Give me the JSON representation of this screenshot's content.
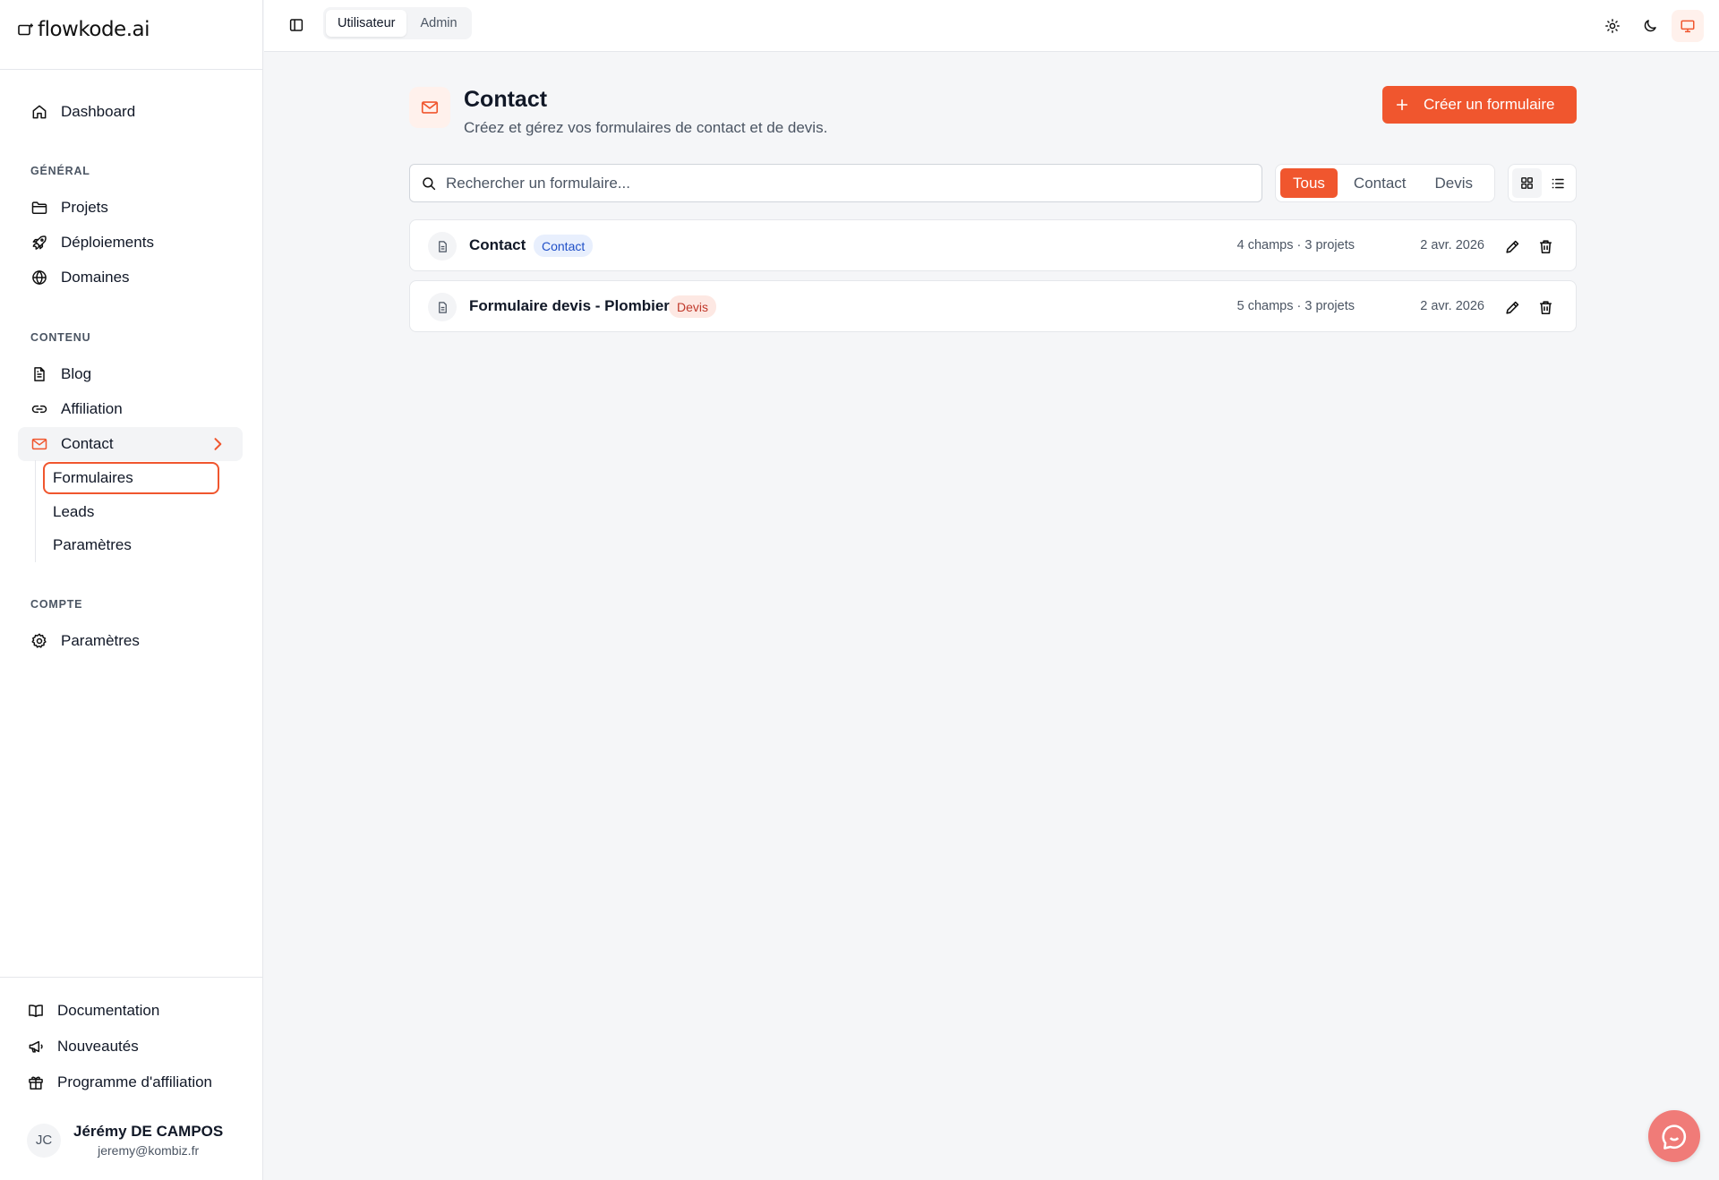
{
  "brand": {
    "logo_text": "flowkode.ai"
  },
  "sidebar": {
    "dashboard": "Dashboard",
    "sections": {
      "general": "GÉNÉRAL",
      "content": "CONTENU",
      "account": "COMPTE"
    },
    "general_items": [
      "Projets",
      "Déploiements",
      "Domaines"
    ],
    "content_items": [
      "Blog",
      "Affiliation",
      "Contact"
    ],
    "contact_sub": [
      "Formulaires",
      "Leads",
      "Paramètres"
    ],
    "account_items": [
      "Paramètres"
    ],
    "footer_links": [
      "Documentation",
      "Nouveautés",
      "Programme d'affiliation"
    ],
    "user": {
      "initials": "JC",
      "name": "Jérémy DE CAMPOS",
      "email": "jeremy@kombiz.fr"
    }
  },
  "topbar": {
    "modes": [
      "Utilisateur",
      "Admin"
    ],
    "active_mode": "Utilisateur",
    "theme_icons": [
      "sun-icon",
      "moon-icon",
      "monitor-icon"
    ],
    "active_theme": "monitor-icon"
  },
  "page": {
    "title": "Contact",
    "subtitle": "Créez et gérez vos formulaires de contact et de devis.",
    "create_button": "Créer un formulaire"
  },
  "search": {
    "placeholder": "Rechercher un formulaire...",
    "value": ""
  },
  "filters": {
    "options": [
      "Tous",
      "Contact",
      "Devis"
    ],
    "active": "Tous"
  },
  "view_mode": "grid",
  "forms": [
    {
      "name": "Contact",
      "type": "Contact",
      "meta": "4 champs · 3 projets",
      "date": "2 avr. 2026"
    },
    {
      "name": "Formulaire devis - Plombier",
      "type": "Devis",
      "meta": "5 champs · 3 projets",
      "date": "2 avr. 2026"
    }
  ],
  "colors": {
    "accent": "#f0562e",
    "accent_soft": "#fff1ec",
    "badge_contact_bg": "#e8effd",
    "badge_contact_text": "#2050c8",
    "badge_devis_bg": "#fde8e3",
    "badge_devis_text": "#c0392b",
    "chat_fab": "#f07b78"
  }
}
